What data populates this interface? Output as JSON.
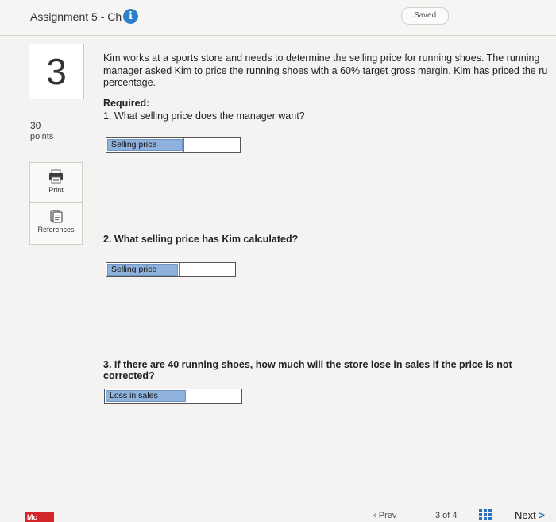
{
  "header": {
    "title": "Assignment 5 - Ch 5",
    "info_icon": "info-icon",
    "saved_label": "Saved"
  },
  "question": {
    "number": "3",
    "points_value": "30",
    "points_label": "points",
    "text": "Kim works at a sports store and needs to determine the selling price for running shoes. The running\nmanager asked Kim to price the running shoes with a 60% target gross margin. Kim has priced the ru\npercentage.",
    "required_heading": "Required:",
    "parts": [
      {
        "prompt": "1. What selling price does the manager want?",
        "field_label": "Selling price",
        "value": ""
      },
      {
        "prompt": "2. What selling price has Kim calculated?",
        "field_label": "Selling price",
        "value": ""
      },
      {
        "prompt": "3. If there are 40 running shoes, how much will the store lose in sales if the price is not corrected?",
        "field_label": "Loss in sales",
        "value": ""
      }
    ]
  },
  "sidebar": {
    "print_label": "Print",
    "print_icon": "printer-icon",
    "references_label": "References",
    "references_icon": "references-icon"
  },
  "footer": {
    "logo_text": "Mc",
    "prev_label": "Prev",
    "page_indicator": "3 of 4",
    "next_label": "Next",
    "next_arrow": ">"
  },
  "colors": {
    "accent": "#2d7fc9",
    "field_label_bg": "#8fb2dd",
    "logo_red": "#d4252b"
  }
}
